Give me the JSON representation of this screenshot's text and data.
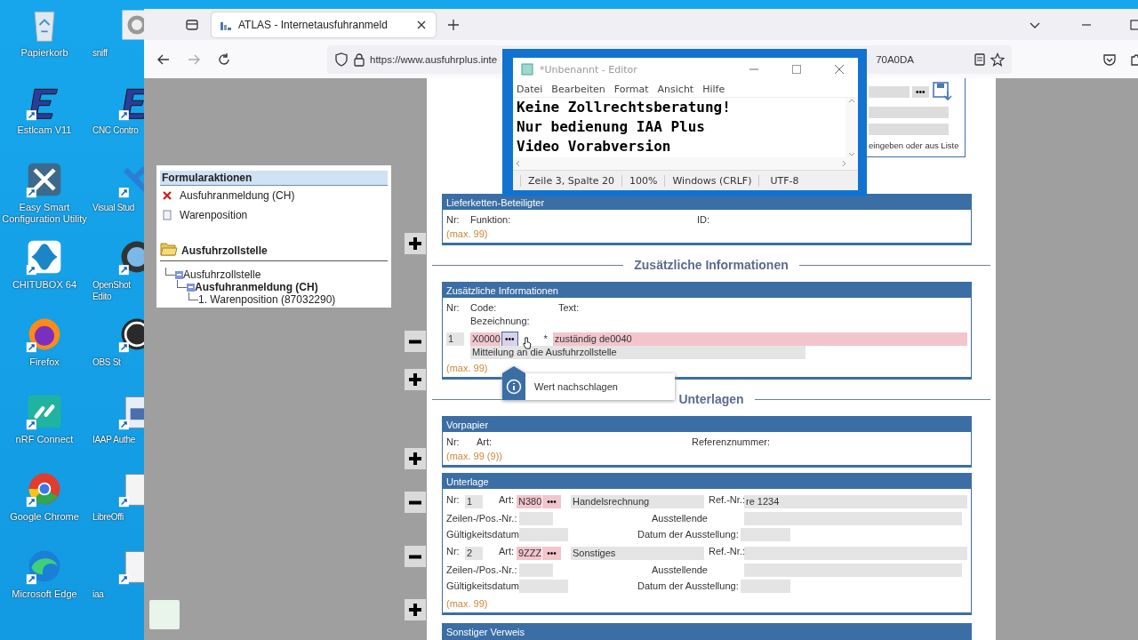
{
  "desktop": {
    "icons": [
      {
        "label": "Papierkorb",
        "kind": "trash"
      },
      {
        "label": "Estlcam V11",
        "kind": "letter"
      },
      {
        "label": "Easy Smart Configuration Utility",
        "kind": "tools"
      },
      {
        "label": "CHITUBOX 64",
        "kind": "cross"
      },
      {
        "label": "Firefox",
        "kind": "fox"
      },
      {
        "label": "nRF Connect",
        "kind": "link"
      },
      {
        "label": "Google Chrome",
        "kind": "chrome"
      },
      {
        "label": "Microsoft Edge",
        "kind": "wave"
      },
      {
        "label": "sniff",
        "kind": "gear"
      },
      {
        "label": "CNC Contro",
        "kind": "letter"
      },
      {
        "label": "Visual Stud",
        "kind": "ribbon"
      },
      {
        "label": "OpenShot Edito",
        "kind": "reel"
      },
      {
        "label": "OBS St",
        "kind": "obs"
      },
      {
        "label": "IAAP Authe",
        "kind": "docblue"
      },
      {
        "label": "LibreOffi",
        "kind": "doc"
      },
      {
        "label": "iaa",
        "kind": "doc"
      }
    ]
  },
  "browser": {
    "tab_title": "ATLAS - Internetausfuhranmeld",
    "url_start": "https://www.ausfuhrplus.inte",
    "url_end": "70A0DA"
  },
  "panel": {
    "title": "Formularaktionen",
    "actions": [
      {
        "label": "Ausfuhranmeldung (CH)",
        "kind": "delete"
      },
      {
        "label": "Warenposition",
        "kind": "new"
      }
    ],
    "folder": "Ausfuhrzollstelle",
    "tree": [
      {
        "label": "Ausfuhrzollstelle",
        "bold": false,
        "expanded": true,
        "children": [
          {
            "label": "Ausfuhranmeldung (CH)",
            "bold": true,
            "expanded": true,
            "children": [
              {
                "label": "1. Warenposition (87032290)",
                "bold": false
              }
            ]
          }
        ]
      }
    ]
  },
  "side_buttons": [
    {
      "kind": "add"
    },
    {
      "kind": "remove"
    },
    {
      "kind": "add"
    },
    {
      "kind": "add"
    },
    {
      "kind": "remove"
    },
    {
      "kind": "remove"
    },
    {
      "kind": "add"
    }
  ],
  "form": {
    "top_box": {
      "lookup": "•••",
      "hint": "eingeben oder aus Liste"
    },
    "sections": [
      {
        "kind": "columns",
        "title": "Lieferketten-Beteiligter",
        "columns": [
          "Nr:",
          "Funktion:",
          "ID:"
        ],
        "max": "(max. 99)"
      },
      {
        "kind": "heading",
        "title": "Zusätzliche Informationen"
      },
      {
        "kind": "info",
        "title": "Zusätzliche Informationen",
        "columns": [
          "Nr:",
          "Code:",
          "Text:"
        ],
        "sub_label": "Bezeichnung:",
        "entries": [
          {
            "nr": "1",
            "code": "X0000",
            "lookup": "•••",
            "hovered": true,
            "required": "*",
            "text": "zuständig de0040",
            "invalid": true,
            "description": "Mitteilung an die Ausfuhrzollstelle"
          }
        ],
        "max": "(max. 99)",
        "tooltip": "Wert nachschlagen"
      },
      {
        "kind": "heading",
        "title": "Unterlagen"
      },
      {
        "kind": "columns",
        "title": "Vorpapier",
        "columns": [
          "Nr:",
          "Art:",
          "Referenznummer:"
        ],
        "max": "(max. 99 (9))"
      },
      {
        "kind": "documents",
        "title": "Unterlage",
        "entries": [
          {
            "labels": [
              "Nr:",
              "Art:",
              "Ref.-Nr.:",
              "Zeilen-/Pos.-Nr.:",
              "Ausstellende",
              "Gültigkeitsdatum:",
              "Datum der Ausstellung:"
            ],
            "nr": "1",
            "code": "N380",
            "lookup": "•••",
            "name": "Handelsrechnung",
            "ref": "re 1234",
            "invalid": true
          },
          {
            "labels": [
              "Nr:",
              "Art:",
              "Ref.-Nr.:",
              "Zeilen-/Pos.-Nr.:",
              "Ausstellende",
              "Gültigkeitsdatum:",
              "Datum der Ausstellung:"
            ],
            "nr": "2",
            "code": "9ZZZ",
            "lookup": "•••",
            "name": "Sonstiges",
            "invalid": true
          }
        ],
        "max": "(max. 99)"
      },
      {
        "kind": "header",
        "title": "Sonstiger Verweis"
      }
    ]
  },
  "notepad": {
    "title": "*Unbenannt - Editor",
    "menu": [
      "Datei",
      "Bearbeiten",
      "Format",
      "Ansicht",
      "Hilfe"
    ],
    "lines": [
      "Keine Zollrechtsberatung!",
      "Nur bedienung IAA Plus",
      "Video Vorabversion"
    ],
    "status": [
      "Zeile 3, Spalte 20",
      "100%",
      "Windows (CRLF)",
      "UTF-8"
    ]
  }
}
